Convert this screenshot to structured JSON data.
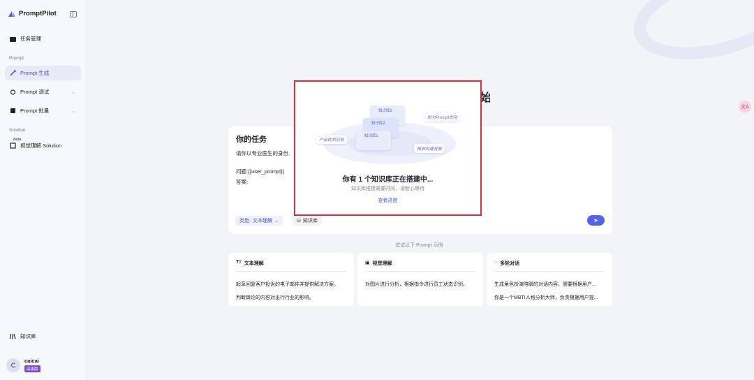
{
  "app": {
    "name": "PromptPilot"
  },
  "sidebar": {
    "task_mgmt": "任务管理",
    "section_prompt": "Prompt",
    "prompt_gen": "Prompt 生成",
    "prompt_debug": "Prompt 调试",
    "prompt_batch": "Prompt 批量",
    "section_solution": "Solution",
    "beta": "beta",
    "visual_solution": "视觉理解 Solution",
    "knowledge": "知识库"
  },
  "user": {
    "name": "caicai",
    "avatar": "C",
    "plan": "高级版"
  },
  "heading_partial": "始",
  "task": {
    "title": "你的任务",
    "line1": "请你以专业医生的身份,",
    "line2": "问题:{{user_prompt}}",
    "line3": "答案:",
    "type_label": "类型:",
    "type_value": "文本理解",
    "kb_label": "知识库"
  },
  "try_text": "试试以下 Prompt 示例",
  "examples": [
    {
      "title": "文本理解",
      "icon": "text-icon",
      "lines": [
        "起草回复客户投诉的电子邮件并提供解决方案。",
        "判断舆论的内容对出行行业的影响。"
      ]
    },
    {
      "title": "视觉理解",
      "icon": "image-icon",
      "lines": [
        "对图片进行分析，根据指令进行员工状态识别。"
      ]
    },
    {
      "title": "多轮对话",
      "icon": "chat-icon",
      "lines": [
        "生成角色扮演陪聊的对话内容，需要根据用户...",
        "你是一个MBTI人格分析大师，负责根据用户提..."
      ]
    }
  ],
  "modal": {
    "title": "你有 1 个知识库正在搭建中...",
    "subtitle": "知识库搭建需要时间，请耐心等待",
    "link": "查看进度",
    "chips": {
      "quality": "产出优质回答",
      "assist": "助力Prompt优化",
      "fast": "精准构建答案"
    },
    "cards": [
      "知识库3",
      "知识库2",
      "知识库1"
    ]
  },
  "colors": {
    "accent": "#5563e8",
    "highlight": "#e22b3a",
    "plan": "#7c4ad6"
  }
}
